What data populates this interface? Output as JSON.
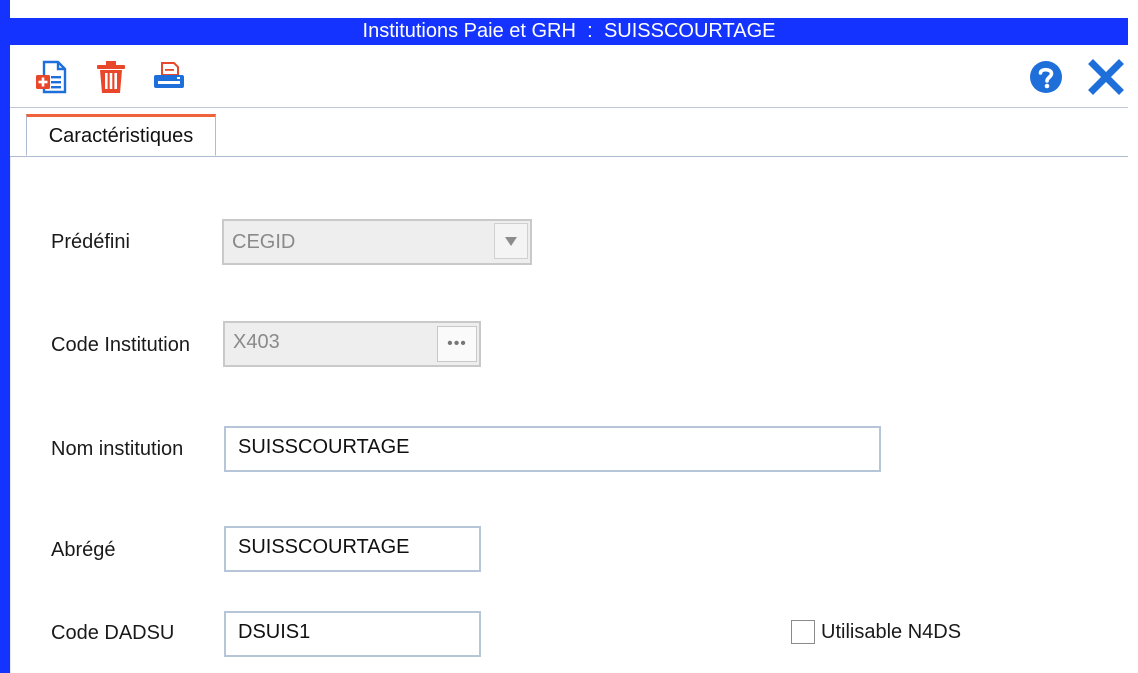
{
  "window": {
    "title_left": "Institutions Paie et GRH",
    "title_sep": ":",
    "title_right": "SUISSCOURTAGE"
  },
  "toolbar": {
    "new_icon": "new-document-icon",
    "delete_icon": "trash-icon",
    "print_icon": "printer-icon",
    "help_icon": "help-icon",
    "close_icon": "close-icon"
  },
  "tabs": [
    {
      "label": "Caractéristiques",
      "active": true
    }
  ],
  "form": {
    "predefini": {
      "label": "Prédéfini",
      "value": "CEGID",
      "disabled": true
    },
    "code_institution": {
      "label": "Code Institution",
      "value": "X403",
      "disabled": true
    },
    "nom_institution": {
      "label": "Nom institution",
      "value": "SUISSCOURTAGE"
    },
    "abrege": {
      "label": "Abrégé",
      "value": "SUISSCOURTAGE"
    },
    "code_dadsu": {
      "label": "Code DADSU",
      "value": "DSUIS1"
    },
    "utilisable_n4ds": {
      "label": "Utilisable N4DS",
      "checked": false
    }
  },
  "colors": {
    "title_bar": "#1533ff",
    "tab_accent": "#f0623a",
    "icon_blue": "#1e6fd9",
    "icon_red": "#e8472b"
  }
}
